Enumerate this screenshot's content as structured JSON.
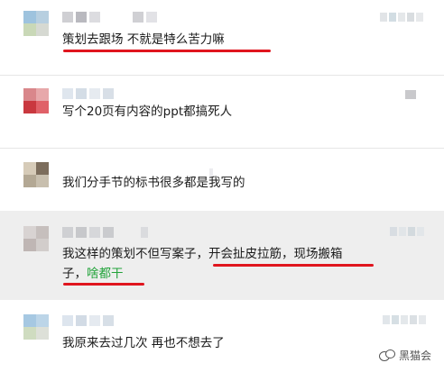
{
  "comments": [
    {
      "text": "策划去跟场  不就是特么苦力嘛"
    },
    {
      "text": "写个20页有内容的ppt都搞死人"
    },
    {
      "text": "我们分手节的标书很多都是我写的"
    },
    {
      "line1": "我这样的策划不但写案子，",
      "line1_hl": "开会扯皮拉筋，现场搬箱",
      "line2": "子，",
      "line2_green": "啥都干"
    },
    {
      "text": "我原来去过几次 再也不想去了"
    }
  ],
  "watermark": {
    "text": "黑猫会",
    "icon": "wechat-icon"
  },
  "colors": {
    "underline": "#e0151e",
    "highlight_text": "#22a33a",
    "highlight_row": "#eeeeee"
  }
}
